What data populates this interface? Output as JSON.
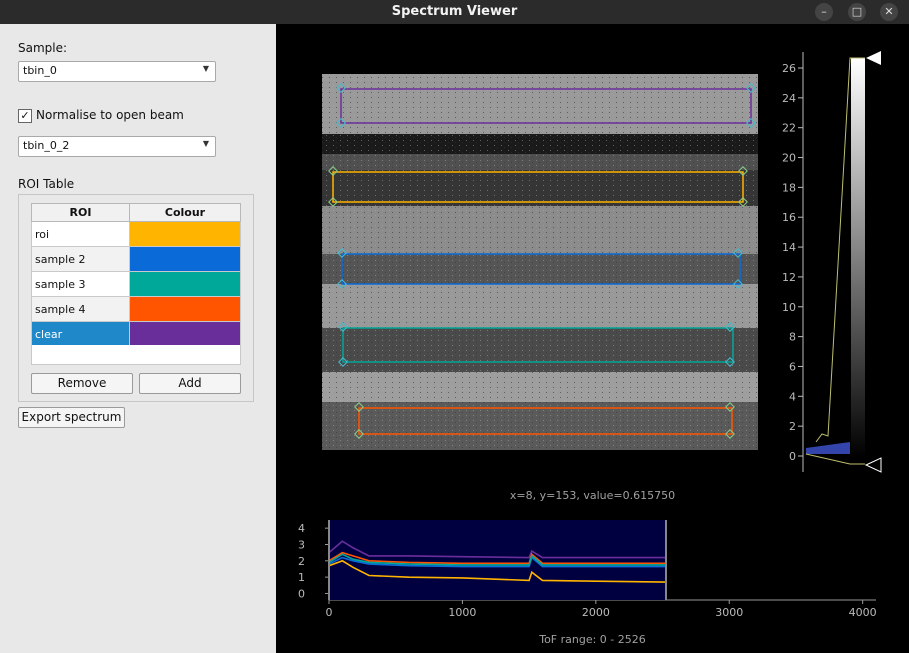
{
  "window": {
    "title": "Spectrum Viewer"
  },
  "sidebar": {
    "sample_label": "Sample:",
    "sample_value": "tbin_0",
    "normalise_label": "Normalise to open beam",
    "normalise_checked": "✓",
    "openbeam_value": "tbin_0_2",
    "roi_table_label": "ROI Table",
    "roi_table": {
      "headers": [
        "ROI",
        "Colour"
      ],
      "rows": [
        {
          "name": "roi",
          "color": "#ffb400"
        },
        {
          "name": "sample 2",
          "color": "#0a6ad8"
        },
        {
          "name": "sample 3",
          "color": "#00a89a"
        },
        {
          "name": "sample 4",
          "color": "#ff5500"
        },
        {
          "name": "clear",
          "color": "#6a2e9a",
          "selected": true
        }
      ]
    },
    "remove_label": "Remove",
    "add_label": "Add",
    "export_label": "Export spectrum"
  },
  "image_view": {
    "colorbar_ticks": [
      "0",
      "2",
      "4",
      "6",
      "8",
      "10",
      "12",
      "14",
      "16",
      "18",
      "20",
      "22",
      "24",
      "26"
    ]
  },
  "status_text": "x=8, y=153, value=0.615750",
  "spectrum": {
    "y_ticks": [
      "0",
      "1",
      "2",
      "3",
      "4"
    ],
    "x_ticks": [
      "0",
      "1000",
      "2000",
      "3000",
      "4000"
    ],
    "tof_range_text": "ToF range: 0 - 2526"
  },
  "chart_data": {
    "type": "line",
    "xlim": [
      0,
      4100
    ],
    "ylim": [
      -0.4,
      4.5
    ],
    "tof_range": [
      0,
      2526
    ],
    "series": [
      {
        "color": "#6a2e9a",
        "x": [
          0,
          100,
          180,
          300,
          600,
          1000,
          1500,
          1520,
          1600,
          2000,
          2526
        ],
        "y": [
          2.5,
          3.2,
          2.8,
          2.3,
          2.3,
          2.25,
          2.2,
          2.6,
          2.2,
          2.2,
          2.2
        ]
      },
      {
        "color": "#ff5500",
        "x": [
          0,
          100,
          180,
          300,
          600,
          1000,
          1500,
          1520,
          1600,
          2000,
          2526
        ],
        "y": [
          2.0,
          2.5,
          2.3,
          2.0,
          1.9,
          1.85,
          1.85,
          2.4,
          1.85,
          1.85,
          1.85
        ]
      },
      {
        "color": "#0a6ad8",
        "x": [
          0,
          100,
          180,
          300,
          600,
          1000,
          1500,
          1520,
          1600,
          2000,
          2526
        ],
        "y": [
          1.8,
          2.2,
          2.0,
          1.8,
          1.7,
          1.65,
          1.65,
          2.2,
          1.65,
          1.65,
          1.65
        ]
      },
      {
        "color": "#00a89a",
        "x": [
          0,
          100,
          180,
          300,
          600,
          1000,
          1500,
          1520,
          1600,
          2000,
          2526
        ],
        "y": [
          1.9,
          2.4,
          2.1,
          1.9,
          1.8,
          1.75,
          1.75,
          2.3,
          1.75,
          1.75,
          1.75
        ]
      },
      {
        "color": "#ffb400",
        "x": [
          0,
          100,
          180,
          300,
          600,
          1000,
          1500,
          1520,
          1600,
          2000,
          2526
        ],
        "y": [
          1.7,
          2.0,
          1.6,
          1.1,
          1.0,
          0.95,
          0.8,
          1.3,
          0.8,
          0.75,
          0.7
        ]
      }
    ]
  }
}
